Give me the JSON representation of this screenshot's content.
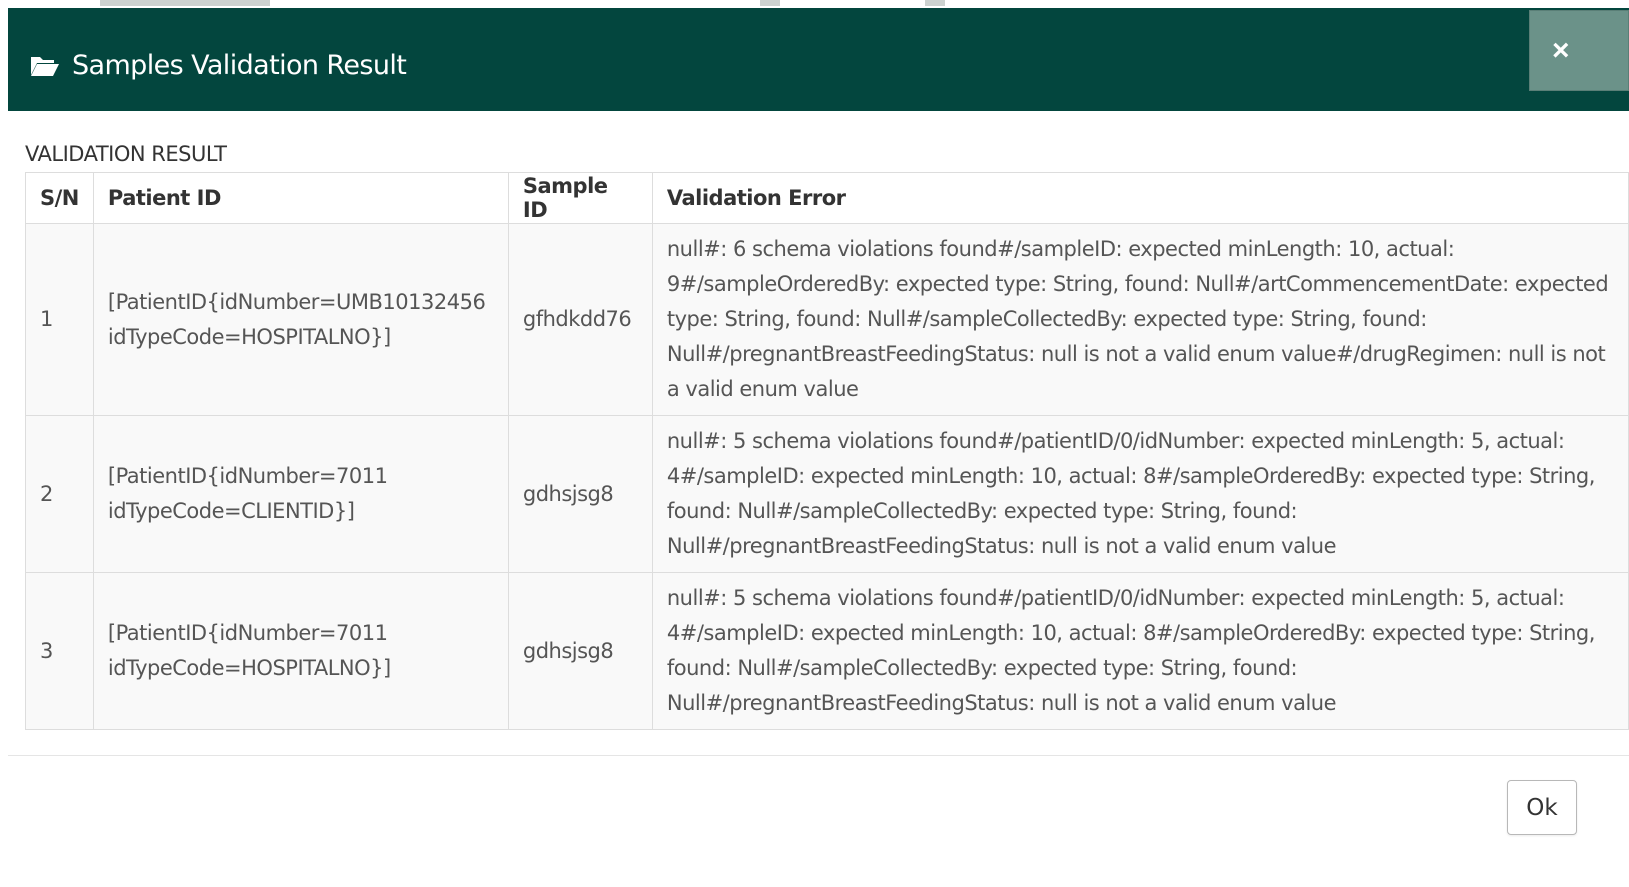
{
  "modal": {
    "title": "Samples Validation Result",
    "title_icon": "folder-open-icon",
    "close_label": "×"
  },
  "section": {
    "label": "VALIDATION RESULT"
  },
  "table": {
    "headers": [
      "S/N",
      "Patient ID",
      "Sample ID",
      "Validation Error"
    ],
    "rows": [
      {
        "sn": "1",
        "patient_id": "[PatientID{idNumber=UMB10132456 idTypeCode=HOSPITALNO}]",
        "sample_id": "gfhdkdd76",
        "error": "null#: 6 schema violations found#/sampleID: expected minLength: 10, actual: 9#/sampleOrderedBy: expected type: String, found: Null#/artCommencementDate: expected type: String, found: Null#/sampleCollectedBy: expected type: String, found: Null#/pregnantBreastFeedingStatus: null is not a valid enum value#/drugRegimen: null is not a valid enum value"
      },
      {
        "sn": "2",
        "patient_id": "[PatientID{idNumber=7011 idTypeCode=CLIENTID}]",
        "sample_id": "gdhsjsg8",
        "error": "null#: 5 schema violations found#/patientID/0/idNumber: expected minLength: 5, actual: 4#/sampleID: expected minLength: 10, actual: 8#/sampleOrderedBy: expected type: String, found: Null#/sampleCollectedBy: expected type: String, found: Null#/pregnantBreastFeedingStatus: null is not a valid enum value"
      },
      {
        "sn": "3",
        "patient_id": "[PatientID{idNumber=7011 idTypeCode=HOSPITALNO}]",
        "sample_id": "gdhsjsg8",
        "error": "null#: 5 schema violations found#/patientID/0/idNumber: expected minLength: 5, actual: 4#/sampleID: expected minLength: 10, actual: 8#/sampleOrderedBy: expected type: String, found: Null#/sampleCollectedBy: expected type: String, found: Null#/pregnantBreastFeedingStatus: null is not a valid enum value"
      }
    ]
  },
  "footer": {
    "ok_label": "Ok"
  },
  "colors": {
    "header_bg": "#03463e",
    "close_bg": "#6b9289",
    "row_bg": "#f9f9f9"
  }
}
